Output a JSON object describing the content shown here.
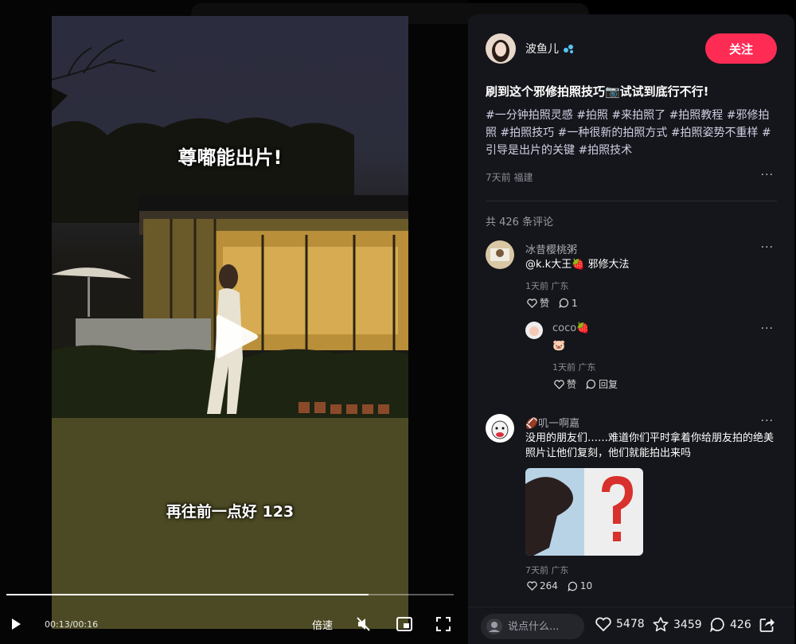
{
  "video": {
    "caption_top": "尊嘟能出片!",
    "caption_bottom": "再往前一点好 123",
    "progress": 0.81
  },
  "controls": {
    "time": "00:13/00:16",
    "speed_label": "倍速"
  },
  "author": {
    "name": "波鱼儿",
    "follow_label": "关注"
  },
  "post": {
    "title": "刷到这个邪修拍照技巧📷试试到底行不行!",
    "tags": [
      "#一分钟拍照灵感",
      "#拍照",
      "#来拍照了",
      "#拍照教程",
      "#邪修拍照",
      "#拍照技巧",
      "#一种很新的拍照方式",
      "#拍照姿势不重样",
      "#引导是出片的关键",
      "#拍照技术"
    ],
    "meta": "7天前 福建",
    "comment_count": "共 426 条评论"
  },
  "comments": [
    {
      "user": "冰昔樱桃粥",
      "text": "@k.k大王🍓 邪修大法",
      "meta": "1天前 广东",
      "like_label": "赞",
      "reply_count": "1",
      "reply": {
        "user": "coco🍓",
        "text": "🐷",
        "meta": "1天前 广东",
        "like_label": "赞",
        "reply_label": "回复"
      }
    },
    {
      "user": "🏈叽一啊嘉",
      "text": "没用的朋友们……难道你们平时拿着你给朋友拍的绝美照片让他们复刻，他们就能拍出来吗",
      "meta": "7天前 广东",
      "likes": "264",
      "replies": "10"
    }
  ],
  "bottom": {
    "input_placeholder": "说点什么...",
    "likes": "5478",
    "favorites": "3459",
    "comments": "426"
  },
  "colors": {
    "accent": "#fe2c55",
    "panel_bg": "#15161b",
    "tag_color": "#cfd0e4"
  }
}
